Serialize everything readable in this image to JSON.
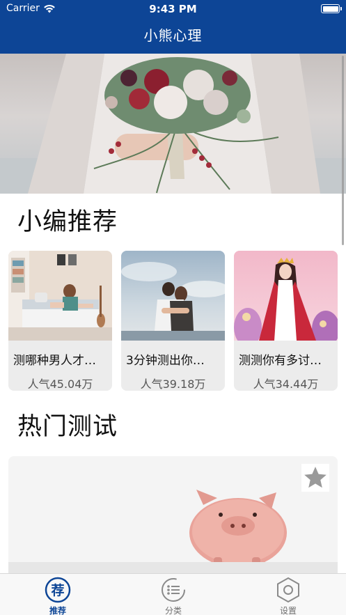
{
  "status_bar": {
    "carrier": "Carrier",
    "time": "9:43 PM"
  },
  "nav": {
    "title": "小熊心理"
  },
  "sections": {
    "recommend_title": "小编推荐",
    "hot_title": "热门测试"
  },
  "recommend_cards": [
    {
      "title": "测哪种男人才…",
      "popularity": "人气45.04万"
    },
    {
      "title": "3分钟测出你…",
      "popularity": "人气39.18万"
    },
    {
      "title": "测测你有多讨…",
      "popularity": "人气34.44万"
    }
  ],
  "tabbar": {
    "tabs": [
      {
        "label": "推荐",
        "icon_char": "荐"
      },
      {
        "label": "分类"
      },
      {
        "label": "设置"
      }
    ]
  },
  "colors": {
    "brand": "#0d4596",
    "card_bg": "#ececec",
    "star": "#9a9a9a"
  }
}
